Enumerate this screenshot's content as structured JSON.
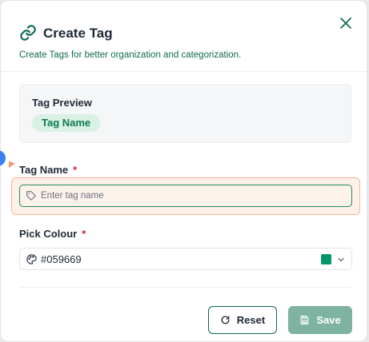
{
  "dialog": {
    "title": "Create Tag",
    "subtitle": "Create Tags for better organization and categorization.",
    "header_icon": "link-icon",
    "close_icon": "close-icon"
  },
  "preview": {
    "title": "Tag Preview",
    "chip_label": "Tag Name",
    "chip_bg": "#daf1e5",
    "chip_color": "#0d7a55"
  },
  "tag_name": {
    "label": "Tag Name",
    "required_mark": "*",
    "placeholder": "Enter tag name",
    "icon": "tag-icon"
  },
  "colour": {
    "label": "Pick Colour",
    "required_mark": "*",
    "value": "#059669",
    "icon": "palette-icon",
    "swatch": "#059669"
  },
  "actions": {
    "reset_label": "Reset",
    "save_label": "Save",
    "reset_icon": "rotate-icon",
    "save_icon": "save-icon"
  },
  "colors": {
    "accent": "#0f6b54",
    "required": "#e11d2e",
    "save_disabled": "#7db3a0",
    "highlight": "#f4b795"
  }
}
